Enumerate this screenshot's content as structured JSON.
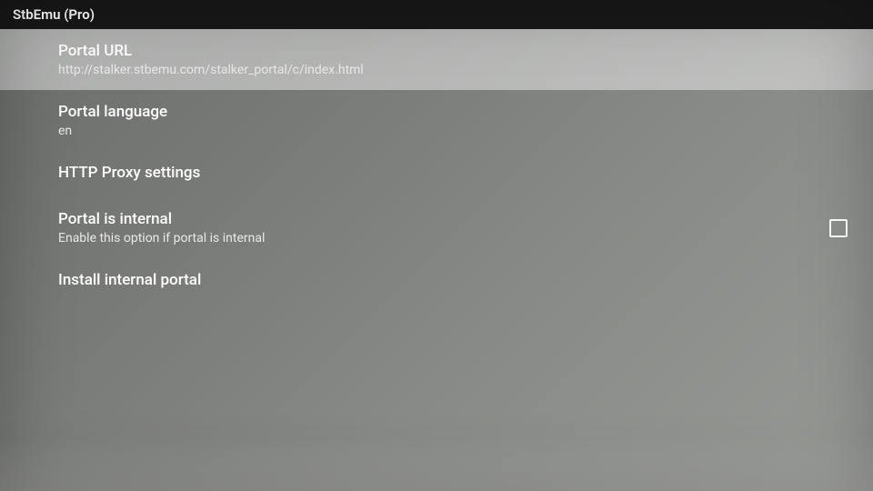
{
  "header": {
    "title": "StbEmu (Pro)"
  },
  "settings": {
    "portal_url": {
      "title": "Portal URL",
      "value": "http://stalker.stbemu.com/stalker_portal/c/index.html"
    },
    "portal_language": {
      "title": "Portal language",
      "value": "en"
    },
    "http_proxy": {
      "title": "HTTP Proxy settings"
    },
    "portal_internal": {
      "title": "Portal is internal",
      "subtitle": "Enable this option if portal is internal",
      "checked": false
    },
    "install_internal": {
      "title": "Install internal portal"
    }
  }
}
